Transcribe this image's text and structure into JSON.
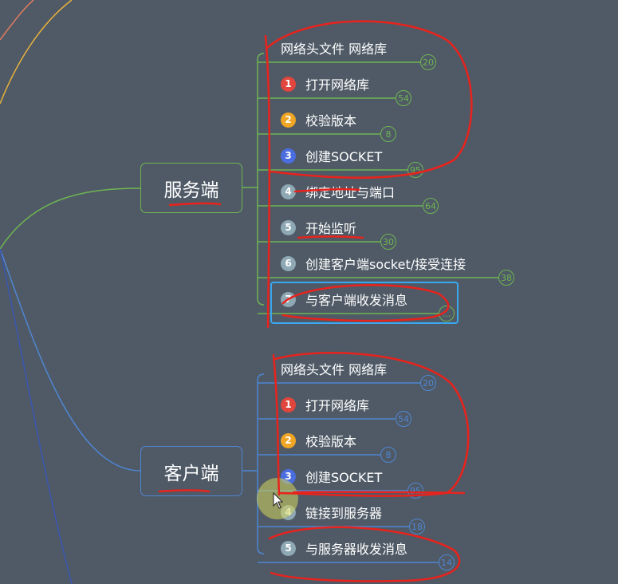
{
  "server": {
    "title": "服务端",
    "items": [
      {
        "label": "网络头文件 网络库",
        "num": "",
        "color": "",
        "count": "20"
      },
      {
        "label": "打开网络库",
        "num": "1",
        "color": "#e0463d",
        "count": "54"
      },
      {
        "label": "校验版本",
        "num": "2",
        "color": "#f0a524",
        "count": "8"
      },
      {
        "label": "创建SOCKET",
        "num": "3",
        "color": "#4a6ee0",
        "count": "95"
      },
      {
        "label": "绑定地址与端口",
        "num": "4",
        "color": "#8ea8b4",
        "count": "64"
      },
      {
        "label": "开始监听",
        "num": "5",
        "color": "#8ea8b4",
        "count": "30"
      },
      {
        "label": "创建客户端socket/接受连接",
        "num": "6",
        "color": "#8ea8b4",
        "count": "38"
      },
      {
        "label": "与客户端收发消息",
        "num": "7",
        "color": "#8ea8b4",
        "count": "..."
      }
    ]
  },
  "client": {
    "title": "客户端",
    "items": [
      {
        "label": "网络头文件 网络库",
        "num": "",
        "color": "",
        "count": "20"
      },
      {
        "label": "打开网络库",
        "num": "1",
        "color": "#e0463d",
        "count": "54"
      },
      {
        "label": "校验版本",
        "num": "2",
        "color": "#f0a524",
        "count": "8"
      },
      {
        "label": "创建SOCKET",
        "num": "3",
        "color": "#4a6ee0",
        "count": "95"
      },
      {
        "label": "链接到服务器",
        "num": "4",
        "color": "#8ea8b4",
        "count": "18"
      },
      {
        "label": "与服务器收发消息",
        "num": "5",
        "color": "#8ea8b4",
        "count": "14"
      }
    ]
  },
  "colors": {
    "background": "#4f5a66",
    "server_branch": "#6fb552",
    "client_branch": "#4f86d3",
    "selection": "#3aa8f0",
    "annotation": "#e8231d"
  }
}
